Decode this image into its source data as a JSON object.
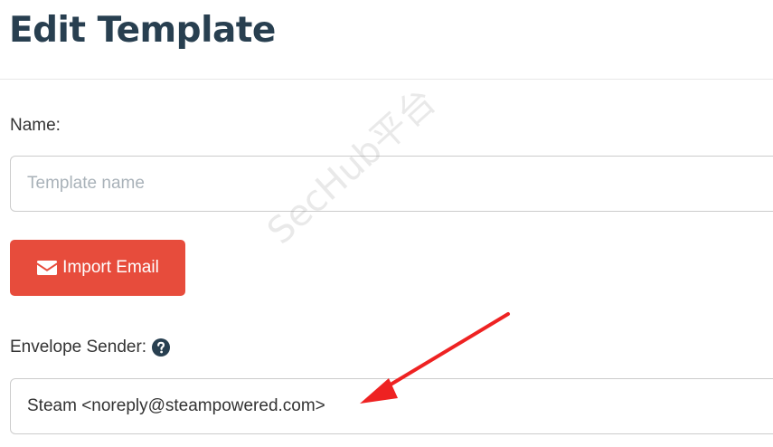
{
  "header": {
    "title": "Edit Template"
  },
  "form": {
    "name_label": "Name:",
    "name_placeholder": "Template name",
    "name_value": "",
    "import_button_label": "Import Email",
    "envelope_label": "Envelope Sender:",
    "envelope_value": "Steam <noreply@steampowered.com>"
  },
  "icons": {
    "import": "envelope-icon",
    "help": "question-circle-icon"
  },
  "watermark": {
    "text": "SecHub平台"
  },
  "colors": {
    "title": "#283f50",
    "import_button": "#e74c3c",
    "annotation_arrow": "#ee2222"
  }
}
